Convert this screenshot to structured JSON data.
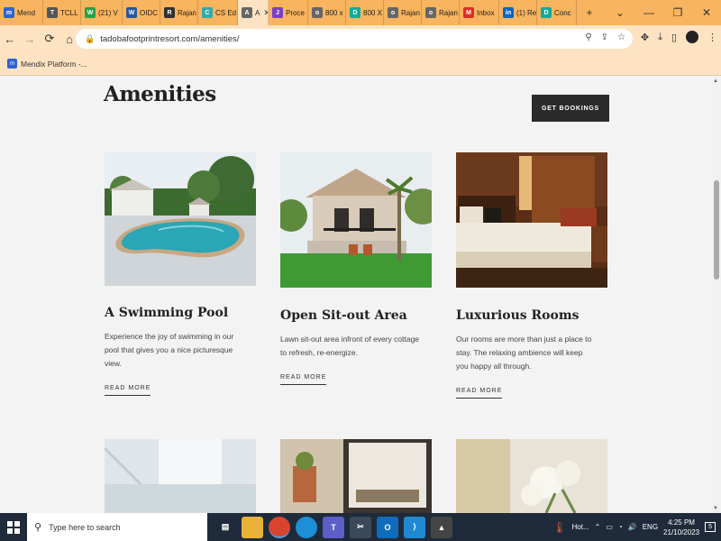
{
  "browser": {
    "tabs": [
      {
        "label": "Mend",
        "fav": "m",
        "color": "#2f63d4"
      },
      {
        "label": "TCLL",
        "fav": "T",
        "color": "#555"
      },
      {
        "label": "(21) V",
        "fav": "W",
        "color": "#25a244"
      },
      {
        "label": "OIDC",
        "fav": "W",
        "color": "#2b579a"
      },
      {
        "label": "Rajan",
        "fav": "R",
        "color": "#333"
      },
      {
        "label": "CS Ed",
        "fav": "C",
        "color": "#3aa"
      },
      {
        "label": "A",
        "fav": "A",
        "color": "#666",
        "active": true
      },
      {
        "label": "Proce",
        "fav": "J",
        "color": "#7a3fc2"
      },
      {
        "label": "800 x",
        "fav": "o",
        "color": "#666"
      },
      {
        "label": "800 X",
        "fav": "D",
        "color": "#1a9"
      },
      {
        "label": "Rajan",
        "fav": "o",
        "color": "#666"
      },
      {
        "label": "Rajan",
        "fav": "o",
        "color": "#666"
      },
      {
        "label": "Inbox",
        "fav": "M",
        "color": "#d93025"
      },
      {
        "label": "(1) Re",
        "fav": "in",
        "color": "#0a66c2"
      },
      {
        "label": "Conc",
        "fav": "D",
        "color": "#1a9"
      }
    ],
    "new_tab": "+",
    "window_controls": [
      "⌄",
      "—",
      "❐",
      "✕"
    ],
    "url": "tadobafootprintresort.com/amenities/",
    "bookmark": "Mendix Platform -..."
  },
  "page": {
    "heading": "Amenities",
    "book_button": "GET BOOKINGS",
    "cards": [
      {
        "title": "A Swimming Pool",
        "desc": "Experience the joy of swimming in our pool that gives you a nice picturesque view.",
        "link": "READ MORE"
      },
      {
        "title": "Open Sit-out Area",
        "desc": "Lawn sit-out area infront of every cottage to refresh, re-energize.",
        "link": "READ MORE"
      },
      {
        "title": "Luxurious Rooms",
        "desc": "Our rooms are more than just a place to stay. The relaxing ambience will keep you happy all through.",
        "link": "READ MORE"
      }
    ]
  },
  "taskbar": {
    "search_placeholder": "Type here to search",
    "weather": "Hot...",
    "lang": "ENG",
    "time": "4:25 PM",
    "date": "21/10/2023",
    "notifications": "5"
  }
}
